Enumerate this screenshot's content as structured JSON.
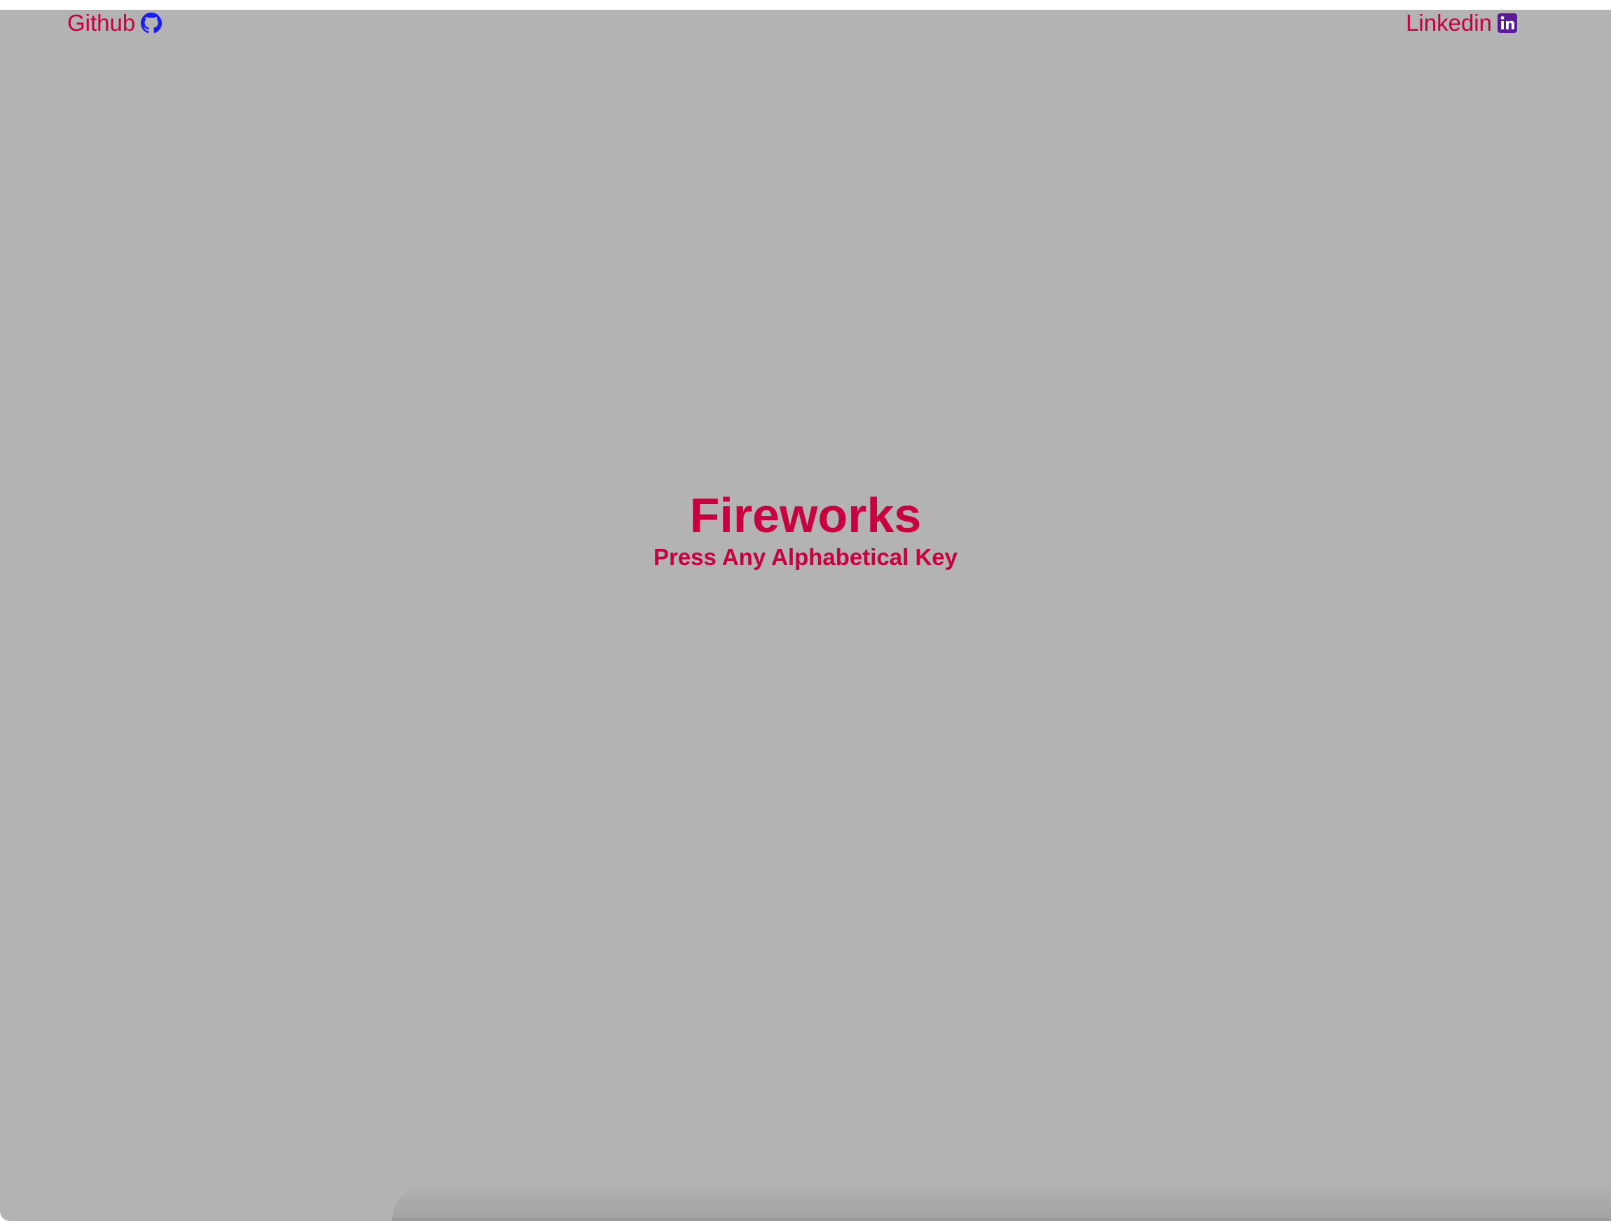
{
  "nav": {
    "github": {
      "label": "Github",
      "icon": "github-icon",
      "icon_color": "#1a1aff"
    },
    "linkedin": {
      "label": "Linkedin",
      "icon": "linkedin-icon",
      "icon_color": "#5a1a9a"
    }
  },
  "main": {
    "title": "Fireworks",
    "subtitle": "Press Any Alphabetical Key"
  },
  "colors": {
    "background": "#b3b3b3",
    "text_accent": "#c8003f"
  }
}
